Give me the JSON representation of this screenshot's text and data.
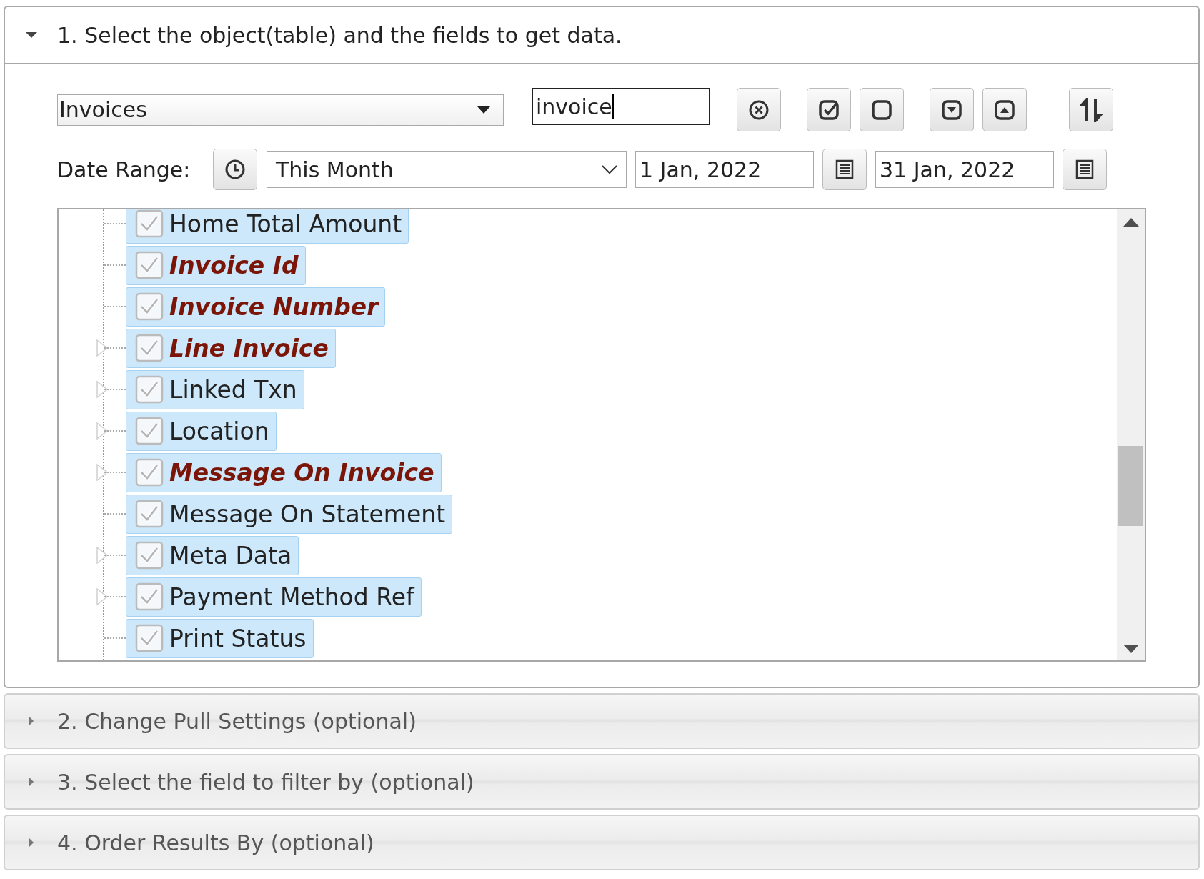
{
  "sections": [
    {
      "title": "1. Select the object(table) and the fields to get data.",
      "expanded": true
    },
    {
      "title": "2. Change Pull Settings (optional)",
      "expanded": false
    },
    {
      "title": "3. Select the field to filter by (optional)",
      "expanded": false
    },
    {
      "title": "4. Order Results By (optional)",
      "expanded": false
    }
  ],
  "object_select": {
    "value": "Invoices"
  },
  "search": {
    "value": "invoice"
  },
  "date_range": {
    "label": "Date Range:",
    "preset": "This Month",
    "from": "1 Jan, 2022",
    "to": "31 Jan, 2022"
  },
  "fields": [
    {
      "label": "Home Total Amount",
      "checked": true,
      "match": false,
      "has_children": false
    },
    {
      "label": "Invoice Id",
      "checked": true,
      "match": true,
      "has_children": false
    },
    {
      "label": "Invoice Number",
      "checked": true,
      "match": true,
      "has_children": false
    },
    {
      "label": "Line Invoice",
      "checked": true,
      "match": true,
      "has_children": true
    },
    {
      "label": "Linked Txn",
      "checked": true,
      "match": false,
      "has_children": true
    },
    {
      "label": "Location",
      "checked": true,
      "match": false,
      "has_children": true
    },
    {
      "label": "Message On Invoice",
      "checked": true,
      "match": true,
      "has_children": true
    },
    {
      "label": "Message On Statement",
      "checked": true,
      "match": false,
      "has_children": false
    },
    {
      "label": "Meta Data",
      "checked": true,
      "match": false,
      "has_children": true
    },
    {
      "label": "Payment Method Ref",
      "checked": true,
      "match": false,
      "has_children": true
    },
    {
      "label": "Print Status",
      "checked": true,
      "match": false,
      "has_children": false
    }
  ]
}
